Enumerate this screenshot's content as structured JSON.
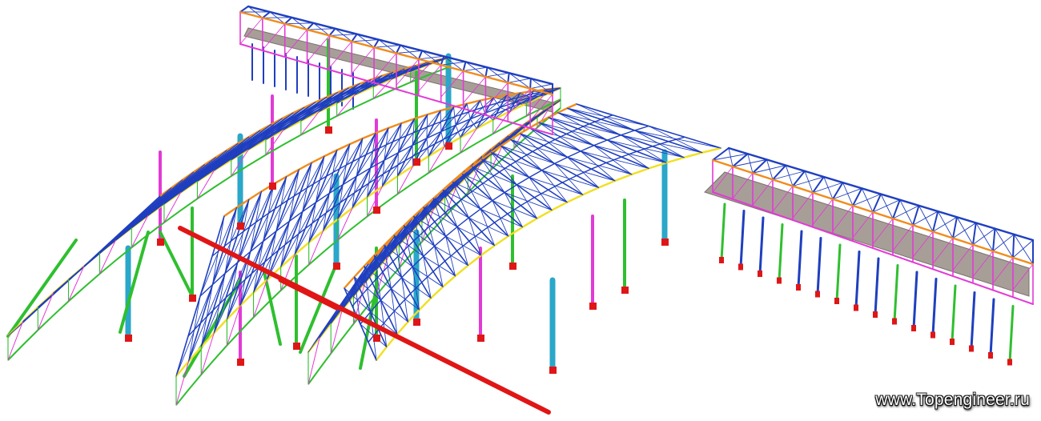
{
  "image": {
    "subject": "3D structural analysis model of steel arched roof trusses with columns and rectangular truss wings",
    "watermark": "www.Topengineer.ru"
  },
  "colors": {
    "background": "#ffffff",
    "top_chord": "#1f3fbf",
    "diagonal": "#2fbf2f",
    "column_cyan": "#2aa7c9",
    "column_magenta": "#e23ad6",
    "base_red": "#e01616",
    "slab_gray": "#a89e98",
    "chord_yellow": "#f0e020",
    "chord_orange": "#f08c1c"
  }
}
